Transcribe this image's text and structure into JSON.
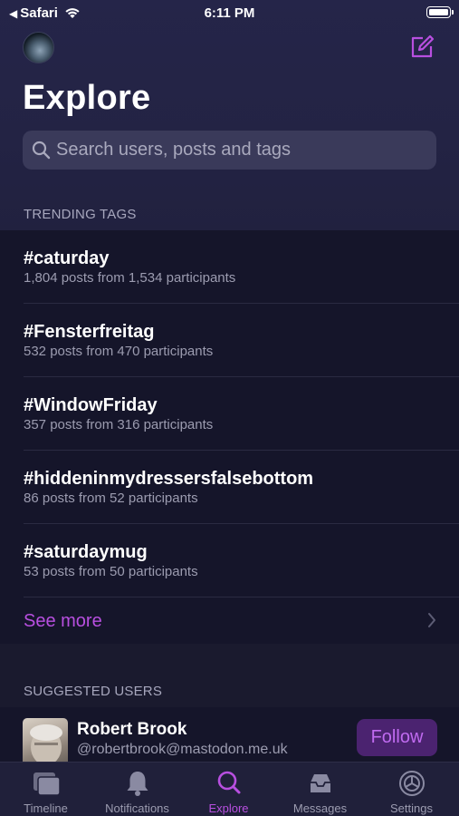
{
  "status_bar": {
    "back_app": "Safari",
    "time": "6:11 PM"
  },
  "header": {
    "title": "Explore"
  },
  "search": {
    "placeholder": "Search users, posts and tags"
  },
  "trending": {
    "header": "TRENDING TAGS",
    "tags": [
      {
        "name": "#caturday",
        "meta": "1,804 posts from 1,534 participants"
      },
      {
        "name": "#Fensterfreitag",
        "meta": "532 posts from 470 participants"
      },
      {
        "name": "#WindowFriday",
        "meta": "357 posts from 316 participants"
      },
      {
        "name": "#hiddeninmydressersfalsebottom",
        "meta": "86 posts from 52 participants"
      },
      {
        "name": "#saturdaymug",
        "meta": "53 posts from 50 participants"
      }
    ],
    "see_more": "See more"
  },
  "suggested": {
    "header": "SUGGESTED USERS",
    "users": [
      {
        "name": "Robert Brook",
        "handle": "@robertbrook@mastodon.me.uk",
        "follow_label": "Follow"
      }
    ]
  },
  "tabbar": {
    "tabs": [
      {
        "label": "Timeline",
        "icon": "timeline-icon"
      },
      {
        "label": "Notifications",
        "icon": "bell-icon"
      },
      {
        "label": "Explore",
        "icon": "search-icon",
        "active": true
      },
      {
        "label": "Messages",
        "icon": "inbox-icon"
      },
      {
        "label": "Settings",
        "icon": "gear-icon"
      }
    ]
  },
  "colors": {
    "accent": "#b84fe0",
    "background": "#1a1a2e",
    "list_background": "#15152a",
    "follow_button_bg": "#4b2370"
  }
}
